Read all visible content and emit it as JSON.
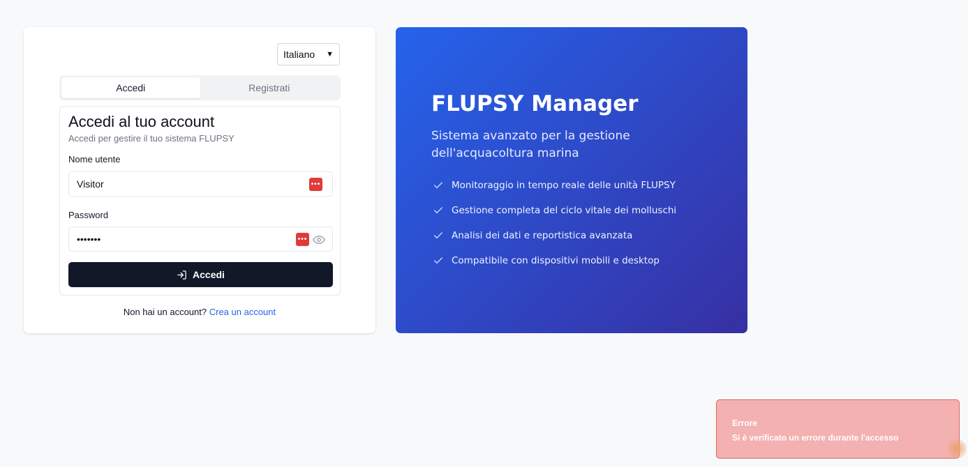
{
  "language_select": {
    "value": "Italiano"
  },
  "tabs": [
    {
      "label": "Accedi",
      "active": true
    },
    {
      "label": "Registrati",
      "active": false
    }
  ],
  "form": {
    "title": "Accedi al tuo account",
    "subtitle": "Accedi per gestire il tuo sistema FLUPSY",
    "username_label": "Nome utente",
    "username_value": "Visitor",
    "password_label": "Password",
    "password_value": "•••••••",
    "submit_label": "Accedi"
  },
  "signup": {
    "prompt": "Non hai un account?",
    "link": "Crea un account"
  },
  "hero": {
    "title": "FLUPSY Manager",
    "subtitle": "Sistema avanzato per la gestione dell'acquacoltura marina",
    "features": [
      "Monitoraggio in tempo reale delle unità FLUPSY",
      "Gestione completa del ciclo vitale dei molluschi",
      "Analisi dei dati e reportistica avanzata",
      "Compatibile con dispositivi mobili e desktop"
    ]
  },
  "toast": {
    "title": "Errore",
    "message": "Si è verificato un errore durante l'accesso"
  },
  "colors": {
    "primary_button": "#111827",
    "hero_gradient_start": "#2563eb",
    "hero_gradient_end": "#3730a3",
    "link": "#2563eb",
    "toast_bg": "#f4b1b1",
    "password_manager_icon": "#e03b3b"
  }
}
